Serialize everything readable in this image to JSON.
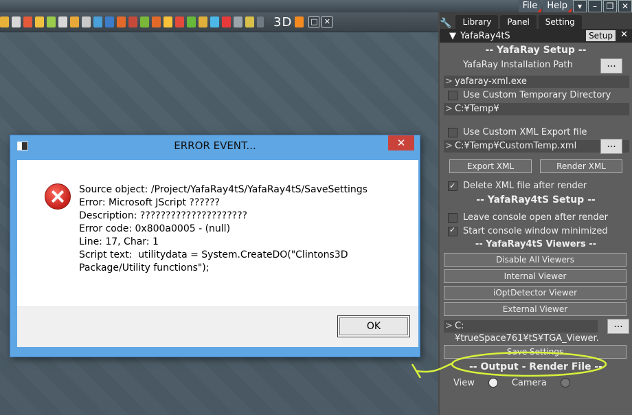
{
  "menus": {
    "file": "File",
    "help": "Help"
  },
  "toolbar": {
    "mode_3d": "3D"
  },
  "panel": {
    "tabs": [
      "Library",
      "Panel",
      "Setting"
    ],
    "plugin_title": "YafaRay4tS",
    "setup_button": "Setup",
    "sections": {
      "yafaray_setup": "-- YafaRay Setup --",
      "yafaray4ts_setup": "-- YafaRay4tS Setup --",
      "viewers": "-- YafaRay4tS Viewers --",
      "output": "-- Output - Render File --"
    },
    "install_path_label": "YafaRay Installation Path",
    "install_path_value": "yafaray-xml.exe",
    "temp_dir_label": "Use Custom Temporary Directory",
    "temp_dir_value": "C:¥Temp¥",
    "xml_export_label": "Use Custom XML Export file",
    "xml_export_value": "C:¥Temp¥CustomTemp.xml",
    "export_xml_button": "Export XML",
    "render_xml_button": "Render XML",
    "delete_xml_label": "Delete XML file after render",
    "leave_console_label": "Leave console open after render",
    "start_minimized_label": "Start console window minimized",
    "disable_viewers_button": "Disable All Viewers",
    "internal_viewer_button": "Internal Viewer",
    "iopt_viewer_button": "iOptDetector Viewer",
    "external_viewer_button": "External Viewer",
    "viewer_path_value": "C:¥trueSpace761¥tS¥TGA_Viewer.",
    "dots": "...",
    "save_settings_button": "Save Settings",
    "view_label": "View",
    "camera_label": "Camera",
    "gt": ">"
  },
  "dialog": {
    "title": "ERROR EVENT...",
    "close": "✕",
    "message": "Source object: /Project/YafaRay4tS/YafaRay4tS/SaveSettings\nError: Microsoft JScript ??????\nDescription: ?????????????????????\nError code: 0x800a0005 - (null)\nLine: 17, Char: 1\nScript text:  utilitydata = System.CreateDO(\"Clintons3D\nPackage/Utility functions\");",
    "ok_button": "OK"
  }
}
